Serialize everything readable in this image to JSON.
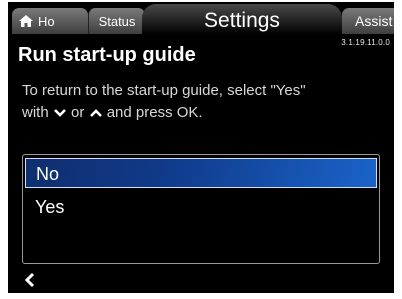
{
  "tabs": {
    "home": "Ho",
    "status": "Status",
    "settings": "Settings",
    "assist": "Assist"
  },
  "version": "3.1.19.11.0.0",
  "title": "Run start-up guide",
  "description": {
    "line1": "To return to the start-up guide, select \"Yes\"",
    "with": "with",
    "or": "or",
    "press": "and press OK."
  },
  "options": [
    {
      "label": "No",
      "selected": true
    },
    {
      "label": "Yes",
      "selected": false
    }
  ],
  "colors": {
    "selection": "#1a63c8",
    "background": "#000000"
  }
}
